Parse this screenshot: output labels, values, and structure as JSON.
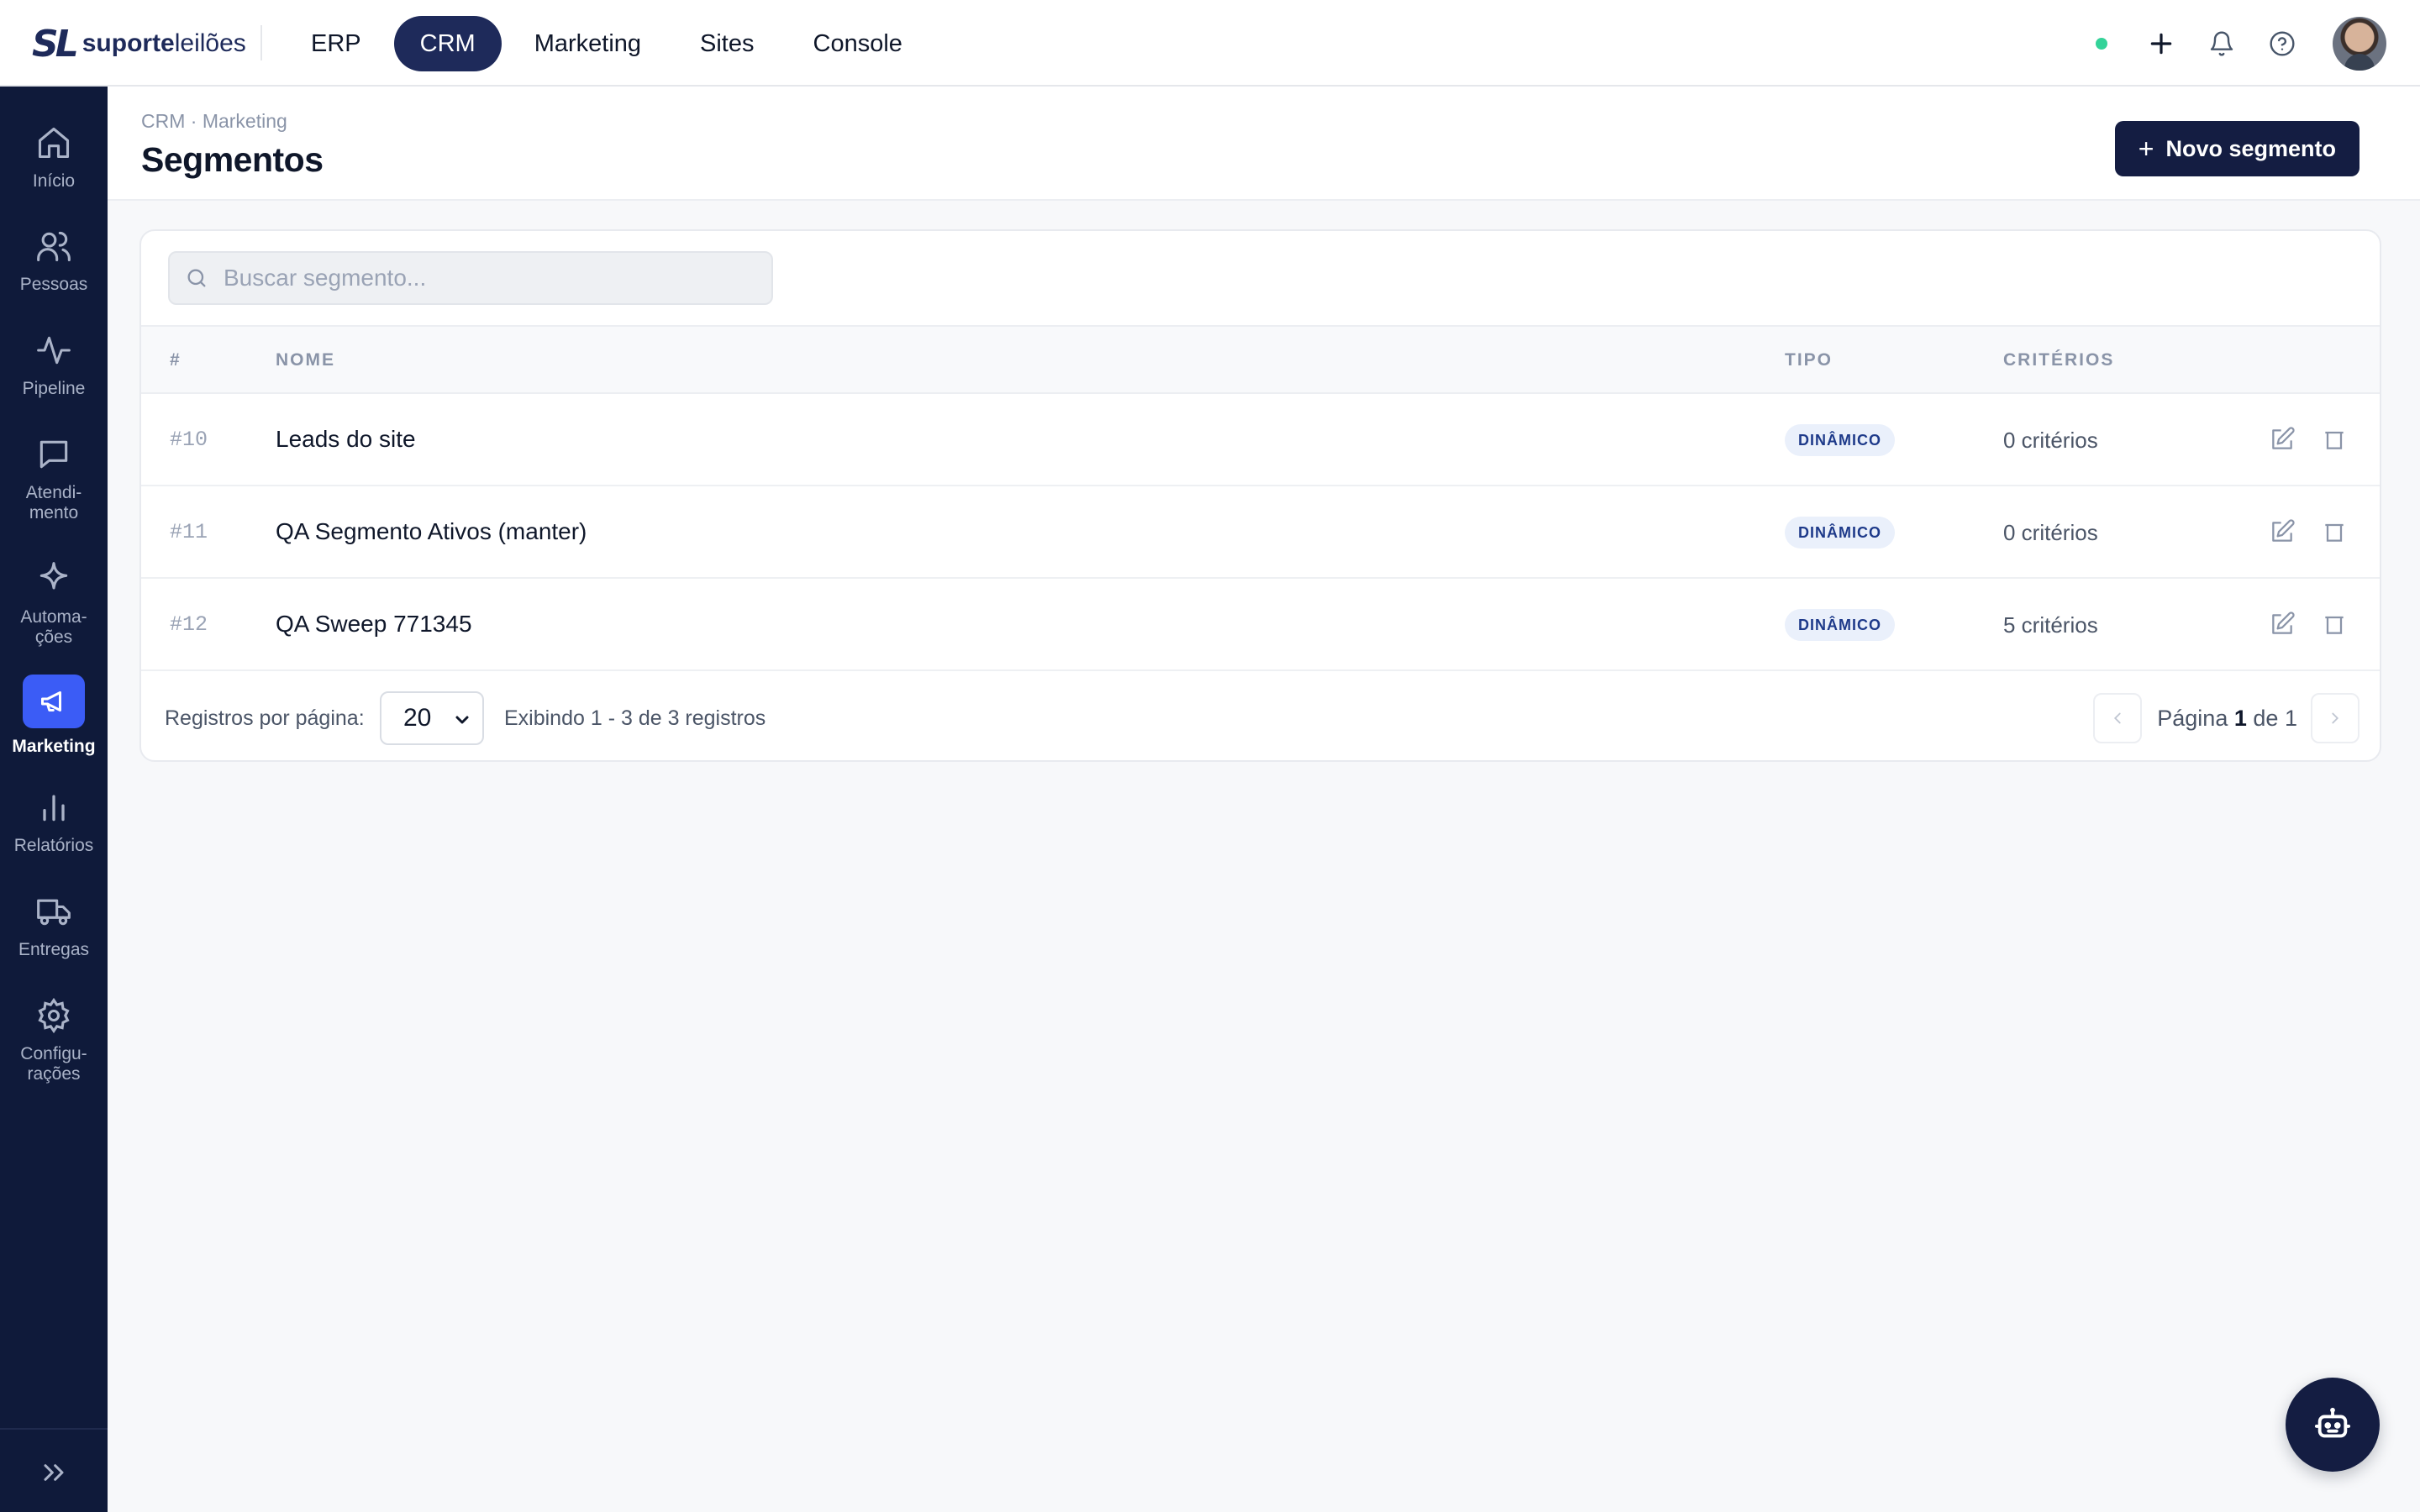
{
  "brand": {
    "mark": "SL",
    "name_bold": "suporte",
    "name_light": "leilões"
  },
  "topnav": {
    "items": [
      {
        "label": "ERP"
      },
      {
        "label": "CRM",
        "active": true
      },
      {
        "label": "Marketing"
      },
      {
        "label": "Sites"
      },
      {
        "label": "Console"
      }
    ]
  },
  "sidebar": {
    "items": [
      {
        "label": "Início",
        "icon": "home-icon"
      },
      {
        "label": "Pessoas",
        "icon": "users-icon"
      },
      {
        "label": "Pipeline",
        "icon": "activity-icon"
      },
      {
        "label1": "Atendi-",
        "label2": "mento",
        "icon": "chat-icon"
      },
      {
        "label1": "Automa-",
        "label2": "ções",
        "icon": "sparkle-icon"
      },
      {
        "label": "Marketing",
        "icon": "megaphone-icon",
        "active": true
      },
      {
        "label": "Relatórios",
        "icon": "bar-chart-icon"
      },
      {
        "label": "Entregas",
        "icon": "truck-icon"
      },
      {
        "label1": "Configu-",
        "label2": "rações",
        "icon": "gear-icon"
      }
    ]
  },
  "header": {
    "breadcrumb": "CRM · Marketing",
    "title": "Segmentos",
    "new_button_label": "Novo segmento"
  },
  "search": {
    "placeholder": "Buscar segmento...",
    "value": ""
  },
  "table": {
    "columns": {
      "id": "#",
      "name": "NOME",
      "type": "TIPO",
      "criteria": "CRITÉRIOS"
    },
    "rows": [
      {
        "id": "#10",
        "name": "Leads do site",
        "type": "DINÂMICO",
        "criteria": "0 critérios"
      },
      {
        "id": "#11",
        "name": "QA Segmento Ativos (manter)",
        "type": "DINÂMICO",
        "criteria": "0 critérios"
      },
      {
        "id": "#12",
        "name": "QA Sweep 771345",
        "type": "DINÂMICO",
        "criteria": "5 critérios"
      }
    ]
  },
  "footer": {
    "per_page_label": "Registros por página:",
    "per_page_value": "20",
    "showing": "Exibindo 1 - 3 de 3 registros",
    "page_prefix": "Página",
    "page_current": "1",
    "page_sep": "de",
    "page_total": "1"
  },
  "colors": {
    "primary": "#141d42",
    "sidebar_bg": "#0f1a3a",
    "active_blue": "#3b5cf6",
    "status_online": "#34d399"
  }
}
